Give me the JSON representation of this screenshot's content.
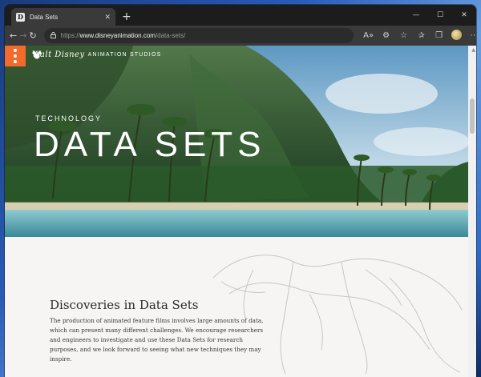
{
  "tab": {
    "favicon_letter": "D",
    "title": "Data Sets",
    "close_glyph": "✕",
    "new_tab_glyph": "+"
  },
  "window_controls": {
    "minimize": "—",
    "maximize": "☐",
    "close": "✕"
  },
  "toolbar": {
    "back": "←",
    "forward": "→",
    "refresh": "↻",
    "url_protocol": "https://",
    "url_host": "www.disneyanimation.com",
    "url_path": "/data-sets/",
    "lock_glyph": "🔒",
    "icons": {
      "read_aloud": "A»",
      "extensions_icon": "⚙",
      "favorites": "☆",
      "favorites_bar": "✰",
      "collections": "❐",
      "more": "⋯"
    }
  },
  "site": {
    "logo_script": "Walt Disney",
    "logo_studios": "ANIMATION STUDIOS",
    "eyebrow": "TECHNOLOGY",
    "hero_title": "DATA SETS",
    "section_title": "Discoveries in Data Sets",
    "section_body": "The production of animated feature films involves large amounts of data, which can present many different challenges. We encourage researchers and engineers to investigate and use these Data Sets for research purposes, and we look forward to seeing what new techniques they may inspire."
  },
  "colors": {
    "menu_button": "#f26b2d",
    "browser_chrome": "#3a3a3a",
    "page_bg": "#f6f5f3"
  }
}
